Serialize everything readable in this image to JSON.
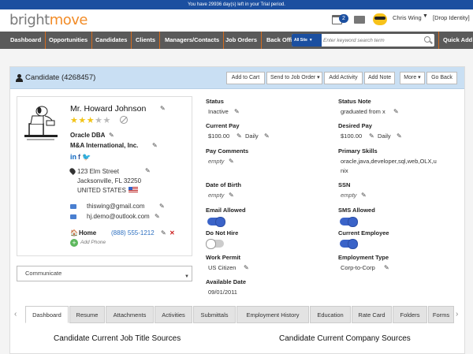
{
  "trial_bar": {
    "text": "You have 29936 day(s) left in your Trial period."
  },
  "header": {
    "logo_part1": "bright",
    "logo_part2": "move",
    "notifications_count": "2",
    "user_name": "Chris Wing",
    "drop_identity": "[Drop Identity]"
  },
  "nav": {
    "items": [
      "Dashboard",
      "Opportunities",
      "Candidates",
      "Clients",
      "Managers/Contacts",
      "Job Orders",
      "Back Office",
      "Quick Add"
    ],
    "search_scope": "All Site",
    "search_placeholder": "Enter keyword search term"
  },
  "panel": {
    "title": "Candidate (4268457)",
    "buttons": [
      "Add to Cart",
      "Send to Job Order ▾",
      "Add Activity",
      "Add Note",
      "More ▾",
      "Go Back"
    ]
  },
  "candidate": {
    "name": "Mr. Howard Johnson",
    "rating": 3,
    "rating_max": 5,
    "dba": "Oracle DBA",
    "company": "M&A International, Inc.",
    "address_line1": "123 Elm Street",
    "address_line2": "Jacksonville, FL 32250",
    "country": "UNITED STATES",
    "email1": "thiswing@gmail.com",
    "email2": "hj.demo@outlook.com",
    "phone_label": "Home",
    "phone": "(888) 555-1212",
    "add_phone": "Add Phone"
  },
  "communicate": {
    "label": "Communicate"
  },
  "fields": {
    "status": {
      "label": "Status",
      "value": "Inactive"
    },
    "status_note": {
      "label": "Status Note",
      "value": "graduated from x"
    },
    "current_pay": {
      "label": "Current Pay",
      "amount": "$100.00",
      "period": "Daily"
    },
    "desired_pay": {
      "label": "Desired Pay",
      "amount": "$100.00",
      "period": "Daily"
    },
    "pay_comments": {
      "label": "Pay Comments",
      "value": "empty"
    },
    "primary_skills": {
      "label": "Primary Skills",
      "line1": "oracle,java,developer,sql,web,OLX,u",
      "line2": "nix"
    },
    "dob": {
      "label": "Date of Birth",
      "value": "empty"
    },
    "ssn": {
      "label": "SSN",
      "value": "empty"
    },
    "email_allowed": {
      "label": "Email Allowed",
      "on": true
    },
    "sms_allowed": {
      "label": "SMS Allowed",
      "on": true
    },
    "do_not_hire": {
      "label": "Do Not Hire",
      "on": false
    },
    "current_employee": {
      "label": "Current Employee",
      "on": true
    },
    "work_permit": {
      "label": "Work Permit",
      "value": "US Citizen"
    },
    "employment_type": {
      "label": "Employment Type",
      "value": "Corp-to-Corp"
    },
    "available_date": {
      "label": "Available Date",
      "value": "09/01/2011"
    }
  },
  "tabs": [
    "Dashboard",
    "Resume",
    "Attachments",
    "Activities",
    "Submittals",
    "Employment History",
    "Education",
    "Rate Card",
    "Folders",
    "Forms"
  ],
  "bottom": {
    "left_title": "Candidate Current Job Title Sources",
    "right_title": "Candidate Current Company Sources"
  },
  "colors": {
    "brand_orange": "#f28c28",
    "brand_blue": "#1b4fa0",
    "nav_gray": "#5a5a5a",
    "panel_head": "#c9dff3"
  }
}
